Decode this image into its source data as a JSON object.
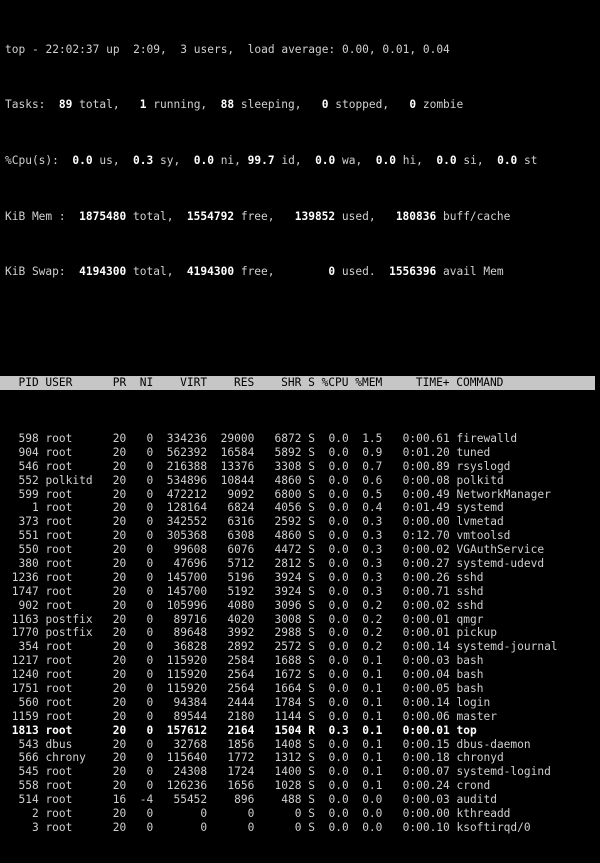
{
  "terminal": {
    "colors": {
      "background": "#000000",
      "foreground": "#d0d0d0",
      "bold_foreground": "#ffffff",
      "header_background": "#c6c6c6",
      "header_foreground": "#000000"
    }
  },
  "summary": {
    "uptime_line": {
      "program": "top",
      "separator": "-",
      "time": "22:02:37",
      "up_label": "up",
      "uptime": "2:09,",
      "users_count": "3",
      "users_label": "users,",
      "load_label": "load average:",
      "load_1min": "0.00,",
      "load_5min": "0.01,",
      "load_15min": "0.04"
    },
    "tasks_line": {
      "label": "Tasks:",
      "total_value": "89",
      "total_label": "total,",
      "running_value": "1",
      "running_label": "running,",
      "sleeping_value": "88",
      "sleeping_label": "sleeping,",
      "stopped_value": "0",
      "stopped_label": "stopped,",
      "zombie_value": "0",
      "zombie_label": "zombie"
    },
    "cpu_line": {
      "label": "%Cpu(s):",
      "us_value": "0.0",
      "us_label": "us,",
      "sy_value": "0.3",
      "sy_label": "sy,",
      "ni_value": "0.0",
      "ni_label": "ni,",
      "id_value": "99.7",
      "id_label": "id,",
      "wa_value": "0.0",
      "wa_label": "wa,",
      "hi_value": "0.0",
      "hi_label": "hi,",
      "si_value": "0.0",
      "si_label": "si,",
      "st_value": "0.0",
      "st_label": "st"
    },
    "mem_line": {
      "label": "KiB Mem :",
      "total_value": "1875480",
      "total_label": "total,",
      "free_value": "1554792",
      "free_label": "free,",
      "used_value": "139852",
      "used_label": "used,",
      "buffcache_value": "180836",
      "buffcache_label": "buff/cache"
    },
    "swap_line": {
      "label": "KiB Swap:",
      "total_value": "4194300",
      "total_label": "total,",
      "free_value": "4194300",
      "free_label": "free,",
      "used_value": "0",
      "used_label": "used.",
      "avail_value": "1556396",
      "avail_label": "avail Mem"
    }
  },
  "table": {
    "columns": [
      "PID",
      "USER",
      "PR",
      "NI",
      "VIRT",
      "RES",
      "SHR",
      "S",
      "%CPU",
      "%MEM",
      "TIME+",
      "COMMAND"
    ],
    "header_text": "  PID USER      PR  NI    VIRT    RES    SHR S %CPU %MEM     TIME+ COMMAND",
    "rows": [
      {
        "pid": "598",
        "user": "root",
        "pr": "20",
        "ni": "0",
        "virt": "334236",
        "res": "29000",
        "shr": "6872",
        "s": "S",
        "cpu": "0.0",
        "mem": "1.5",
        "time": "0:00.61",
        "command": "firewalld",
        "selected": false
      },
      {
        "pid": "904",
        "user": "root",
        "pr": "20",
        "ni": "0",
        "virt": "562392",
        "res": "16584",
        "shr": "5892",
        "s": "S",
        "cpu": "0.0",
        "mem": "0.9",
        "time": "0:01.20",
        "command": "tuned",
        "selected": false
      },
      {
        "pid": "546",
        "user": "root",
        "pr": "20",
        "ni": "0",
        "virt": "216388",
        "res": "13376",
        "shr": "3308",
        "s": "S",
        "cpu": "0.0",
        "mem": "0.7",
        "time": "0:00.89",
        "command": "rsyslogd",
        "selected": false
      },
      {
        "pid": "552",
        "user": "polkitd",
        "pr": "20",
        "ni": "0",
        "virt": "534896",
        "res": "10844",
        "shr": "4860",
        "s": "S",
        "cpu": "0.0",
        "mem": "0.6",
        "time": "0:00.08",
        "command": "polkitd",
        "selected": false
      },
      {
        "pid": "599",
        "user": "root",
        "pr": "20",
        "ni": "0",
        "virt": "472212",
        "res": "9092",
        "shr": "6800",
        "s": "S",
        "cpu": "0.0",
        "mem": "0.5",
        "time": "0:00.49",
        "command": "NetworkManager",
        "selected": false
      },
      {
        "pid": "1",
        "user": "root",
        "pr": "20",
        "ni": "0",
        "virt": "128164",
        "res": "6824",
        "shr": "4056",
        "s": "S",
        "cpu": "0.0",
        "mem": "0.4",
        "time": "0:01.49",
        "command": "systemd",
        "selected": false
      },
      {
        "pid": "373",
        "user": "root",
        "pr": "20",
        "ni": "0",
        "virt": "342552",
        "res": "6316",
        "shr": "2592",
        "s": "S",
        "cpu": "0.0",
        "mem": "0.3",
        "time": "0:00.00",
        "command": "lvmetad",
        "selected": false
      },
      {
        "pid": "551",
        "user": "root",
        "pr": "20",
        "ni": "0",
        "virt": "305368",
        "res": "6308",
        "shr": "4860",
        "s": "S",
        "cpu": "0.0",
        "mem": "0.3",
        "time": "0:12.70",
        "command": "vmtoolsd",
        "selected": false
      },
      {
        "pid": "550",
        "user": "root",
        "pr": "20",
        "ni": "0",
        "virt": "99608",
        "res": "6076",
        "shr": "4472",
        "s": "S",
        "cpu": "0.0",
        "mem": "0.3",
        "time": "0:00.02",
        "command": "VGAuthService",
        "selected": false
      },
      {
        "pid": "380",
        "user": "root",
        "pr": "20",
        "ni": "0",
        "virt": "47696",
        "res": "5712",
        "shr": "2812",
        "s": "S",
        "cpu": "0.0",
        "mem": "0.3",
        "time": "0:00.27",
        "command": "systemd-udevd",
        "selected": false
      },
      {
        "pid": "1236",
        "user": "root",
        "pr": "20",
        "ni": "0",
        "virt": "145700",
        "res": "5196",
        "shr": "3924",
        "s": "S",
        "cpu": "0.0",
        "mem": "0.3",
        "time": "0:00.26",
        "command": "sshd",
        "selected": false
      },
      {
        "pid": "1747",
        "user": "root",
        "pr": "20",
        "ni": "0",
        "virt": "145700",
        "res": "5192",
        "shr": "3924",
        "s": "S",
        "cpu": "0.0",
        "mem": "0.3",
        "time": "0:00.71",
        "command": "sshd",
        "selected": false
      },
      {
        "pid": "902",
        "user": "root",
        "pr": "20",
        "ni": "0",
        "virt": "105996",
        "res": "4080",
        "shr": "3096",
        "s": "S",
        "cpu": "0.0",
        "mem": "0.2",
        "time": "0:00.02",
        "command": "sshd",
        "selected": false
      },
      {
        "pid": "1163",
        "user": "postfix",
        "pr": "20",
        "ni": "0",
        "virt": "89716",
        "res": "4020",
        "shr": "3008",
        "s": "S",
        "cpu": "0.0",
        "mem": "0.2",
        "time": "0:00.01",
        "command": "qmgr",
        "selected": false
      },
      {
        "pid": "1770",
        "user": "postfix",
        "pr": "20",
        "ni": "0",
        "virt": "89648",
        "res": "3992",
        "shr": "2988",
        "s": "S",
        "cpu": "0.0",
        "mem": "0.2",
        "time": "0:00.01",
        "command": "pickup",
        "selected": false
      },
      {
        "pid": "354",
        "user": "root",
        "pr": "20",
        "ni": "0",
        "virt": "36828",
        "res": "2892",
        "shr": "2572",
        "s": "S",
        "cpu": "0.0",
        "mem": "0.2",
        "time": "0:00.14",
        "command": "systemd-journal",
        "selected": false
      },
      {
        "pid": "1217",
        "user": "root",
        "pr": "20",
        "ni": "0",
        "virt": "115920",
        "res": "2584",
        "shr": "1688",
        "s": "S",
        "cpu": "0.0",
        "mem": "0.1",
        "time": "0:00.03",
        "command": "bash",
        "selected": false
      },
      {
        "pid": "1240",
        "user": "root",
        "pr": "20",
        "ni": "0",
        "virt": "115920",
        "res": "2564",
        "shr": "1672",
        "s": "S",
        "cpu": "0.0",
        "mem": "0.1",
        "time": "0:00.04",
        "command": "bash",
        "selected": false
      },
      {
        "pid": "1751",
        "user": "root",
        "pr": "20",
        "ni": "0",
        "virt": "115920",
        "res": "2564",
        "shr": "1664",
        "s": "S",
        "cpu": "0.0",
        "mem": "0.1",
        "time": "0:00.05",
        "command": "bash",
        "selected": false
      },
      {
        "pid": "560",
        "user": "root",
        "pr": "20",
        "ni": "0",
        "virt": "94384",
        "res": "2444",
        "shr": "1784",
        "s": "S",
        "cpu": "0.0",
        "mem": "0.1",
        "time": "0:00.14",
        "command": "login",
        "selected": false
      },
      {
        "pid": "1159",
        "user": "root",
        "pr": "20",
        "ni": "0",
        "virt": "89544",
        "res": "2180",
        "shr": "1144",
        "s": "S",
        "cpu": "0.0",
        "mem": "0.1",
        "time": "0:00.06",
        "command": "master",
        "selected": false
      },
      {
        "pid": "1813",
        "user": "root",
        "pr": "20",
        "ni": "0",
        "virt": "157612",
        "res": "2164",
        "shr": "1504",
        "s": "R",
        "cpu": "0.3",
        "mem": "0.1",
        "time": "0:00.01",
        "command": "top",
        "selected": true
      },
      {
        "pid": "543",
        "user": "dbus",
        "pr": "20",
        "ni": "0",
        "virt": "32768",
        "res": "1856",
        "shr": "1408",
        "s": "S",
        "cpu": "0.0",
        "mem": "0.1",
        "time": "0:00.15",
        "command": "dbus-daemon",
        "selected": false
      },
      {
        "pid": "566",
        "user": "chrony",
        "pr": "20",
        "ni": "0",
        "virt": "115640",
        "res": "1772",
        "shr": "1312",
        "s": "S",
        "cpu": "0.0",
        "mem": "0.1",
        "time": "0:00.18",
        "command": "chronyd",
        "selected": false
      },
      {
        "pid": "545",
        "user": "root",
        "pr": "20",
        "ni": "0",
        "virt": "24308",
        "res": "1724",
        "shr": "1400",
        "s": "S",
        "cpu": "0.0",
        "mem": "0.1",
        "time": "0:00.07",
        "command": "systemd-logind",
        "selected": false
      },
      {
        "pid": "558",
        "user": "root",
        "pr": "20",
        "ni": "0",
        "virt": "126236",
        "res": "1656",
        "shr": "1028",
        "s": "S",
        "cpu": "0.0",
        "mem": "0.1",
        "time": "0:00.24",
        "command": "crond",
        "selected": false
      },
      {
        "pid": "514",
        "user": "root",
        "pr": "16",
        "ni": "-4",
        "virt": "55452",
        "res": "896",
        "shr": "488",
        "s": "S",
        "cpu": "0.0",
        "mem": "0.0",
        "time": "0:00.03",
        "command": "auditd",
        "selected": false
      },
      {
        "pid": "2",
        "user": "root",
        "pr": "20",
        "ni": "0",
        "virt": "0",
        "res": "0",
        "shr": "0",
        "s": "S",
        "cpu": "0.0",
        "mem": "0.0",
        "time": "0:00.00",
        "command": "kthreadd",
        "selected": false
      },
      {
        "pid": "3",
        "user": "root",
        "pr": "20",
        "ni": "0",
        "virt": "0",
        "res": "0",
        "shr": "0",
        "s": "S",
        "cpu": "0.0",
        "mem": "0.0",
        "time": "0:00.10",
        "command": "ksoftirqd/0",
        "selected": false
      }
    ]
  }
}
